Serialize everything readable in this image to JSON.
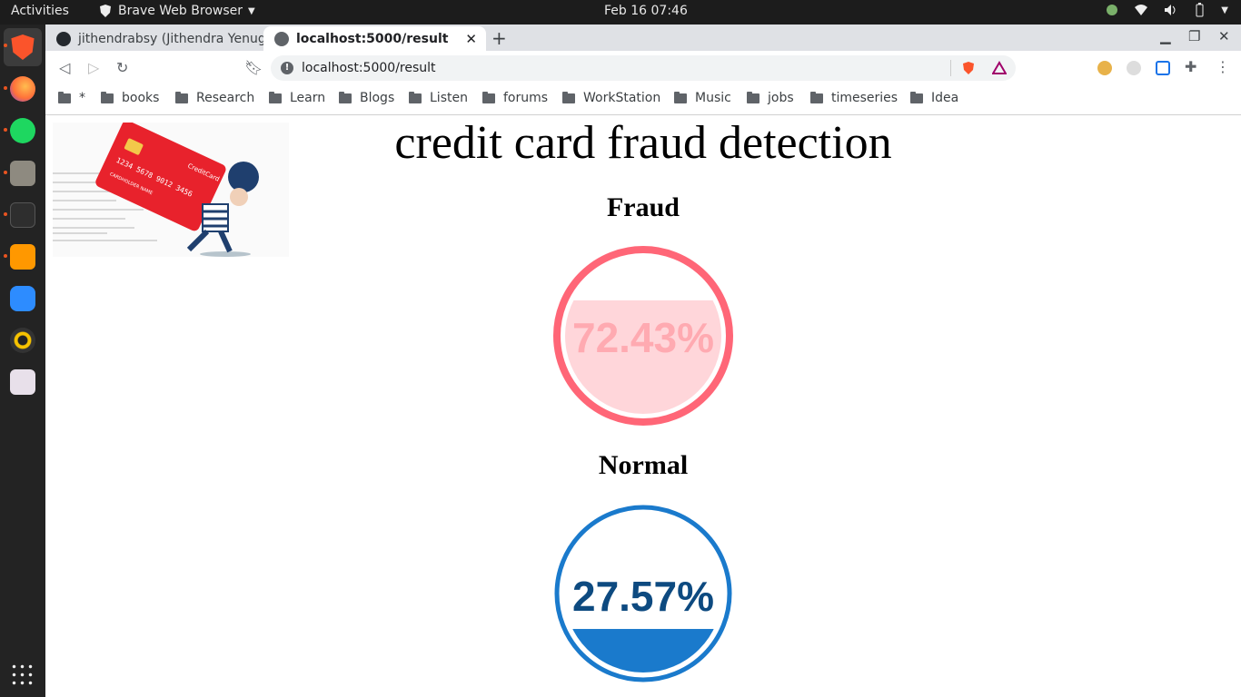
{
  "system": {
    "activities": "Activities",
    "app_name": "Brave Web Browser",
    "clock": "Feb 16  07:46"
  },
  "browser": {
    "tabs": [
      {
        "label": "jithendrabsy (Jithendra Yenugu",
        "active": false
      },
      {
        "label": "localhost:5000/result",
        "active": true
      }
    ],
    "url": "localhost:5000/result",
    "bookmarks": [
      "*",
      "books",
      "Research",
      "Learn",
      "Blogs",
      "Listen",
      "forums",
      "WorkStation",
      "Music",
      "jobs",
      "timeseries",
      "Idea"
    ]
  },
  "page": {
    "title": "credit card fraud detection",
    "fraud": {
      "label": "Fraud",
      "percent_text": "72.43%",
      "value": 72.43,
      "color": "#ff6677"
    },
    "normal": {
      "label": "Normal",
      "percent_text": "27.57%",
      "value": 27.57,
      "color": "#1a7acc"
    },
    "image": {
      "card_text_brand": "CreditCard",
      "card_number": "1234  5678  9012  3456",
      "card_holder": "CARDHOLDER NAME"
    }
  }
}
